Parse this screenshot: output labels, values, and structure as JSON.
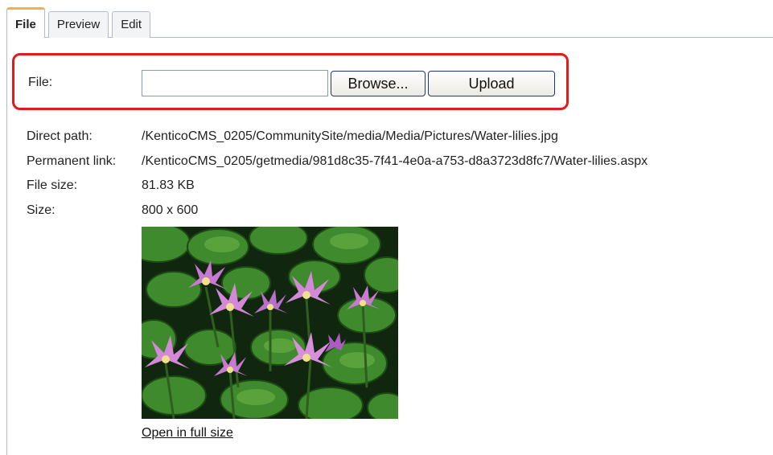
{
  "tabs": [
    {
      "label": "File",
      "active": true
    },
    {
      "label": "Preview",
      "active": false
    },
    {
      "label": "Edit",
      "active": false
    }
  ],
  "upload": {
    "label": "File:",
    "input_value": "",
    "browse_label": "Browse...",
    "upload_label": "Upload",
    "highlight_color": "#e01b1b"
  },
  "details": {
    "direct_path_label": "Direct path:",
    "direct_path_value": "/KenticoCMS_0205/CommunitySite/media/Media/Pictures/Water-lilies.jpg",
    "permanent_link_label": "Permanent link:",
    "permanent_link_value": "/KenticoCMS_0205/getmedia/981d8c35-7f41-4e0a-a753-d8a3723d8fc7/Water-lilies.aspx",
    "file_size_label": "File size:",
    "file_size_value": "81.83 KB",
    "size_label": "Size:",
    "size_value": "800 x 600"
  },
  "preview": {
    "image_name": "water-lilies-image",
    "open_link": "Open in full size"
  }
}
